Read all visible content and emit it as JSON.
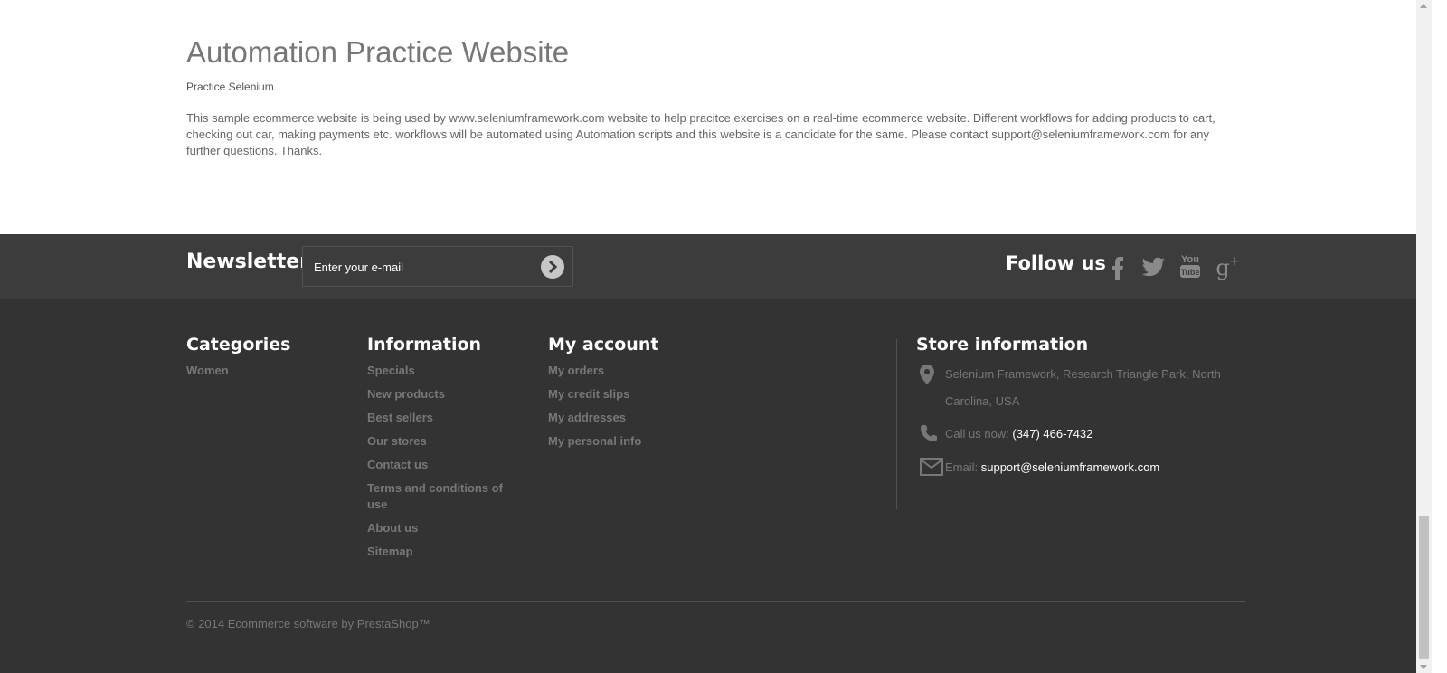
{
  "intro": {
    "title": "Automation Practice Website",
    "subtitle": "Practice Selenium",
    "description": "This sample ecommerce website is being used by www.seleniumframework.com website to help pracitce exercises on a real-time ecommerce website. Different workflows for adding products to cart, checking out car, making payments etc. workflows will be automated using Automation scripts and this website is a candidate for the same. Please contact support@seleniumframework.com for any further questions. Thanks."
  },
  "newsletter": {
    "title": "Newsletter",
    "placeholder": "Enter your e-mail",
    "submit_icon": "chevron-right-circle-icon"
  },
  "follow": {
    "title": "Follow us",
    "icons": [
      "facebook-icon",
      "twitter-icon",
      "youtube-icon",
      "google-plus-icon"
    ]
  },
  "categories": {
    "title": "Categories",
    "items": [
      "Women"
    ]
  },
  "information": {
    "title": "Information",
    "items": [
      "Specials",
      "New products",
      "Best sellers",
      "Our stores",
      "Contact us",
      "Terms and conditions of use",
      "About us",
      "Sitemap"
    ]
  },
  "account": {
    "title": "My account",
    "items": [
      "My orders",
      "My credit slips",
      "My addresses",
      "My personal info"
    ]
  },
  "store": {
    "title": "Store information",
    "address": "Selenium Framework, Research Triangle Park, North Carolina, USA",
    "phone_label": "Call us now: ",
    "phone": "(347) 466-7432",
    "email_label": "Email: ",
    "email": "support@seleniumframework.com"
  },
  "copyright": "© 2014 Ecommerce software by PrestaShop™",
  "colors": {
    "footer_bg": "#333333",
    "newsletter_bg": "#3c3c3c",
    "link": "#777777"
  }
}
